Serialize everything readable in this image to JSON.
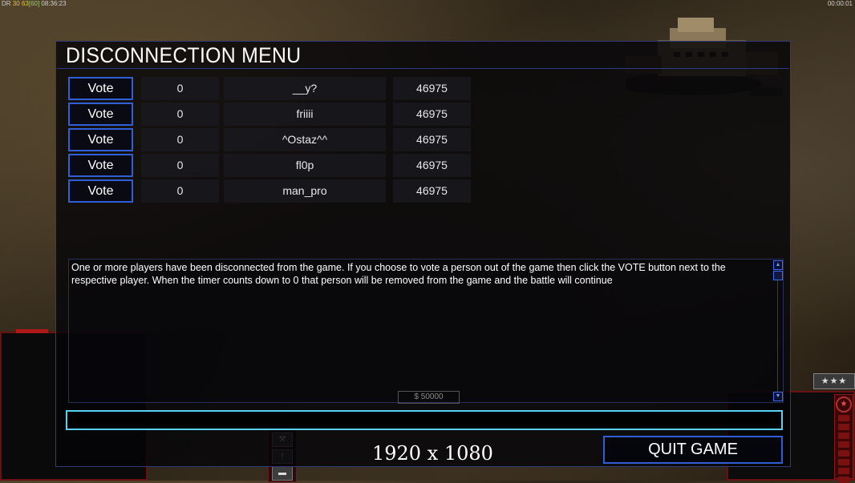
{
  "hud": {
    "top_left_prefix": "DR",
    "top_left_fps": "30",
    "top_left_a": "63",
    "top_left_b": "[60]",
    "top_left_clock": "08:36:23",
    "top_right_timer": "00:00:01"
  },
  "dialog": {
    "title": "DISCONNECTION MENU",
    "players": [
      {
        "vote_label": "Vote",
        "timer": "0",
        "name": "__y?",
        "ping": "46975"
      },
      {
        "vote_label": "Vote",
        "timer": "0",
        "name": "friiii",
        "ping": "46975"
      },
      {
        "vote_label": "Vote",
        "timer": "0",
        "name": "^Ostaz^^",
        "ping": "46975"
      },
      {
        "vote_label": "Vote",
        "timer": "0",
        "name": "fl0p",
        "ping": "46975"
      },
      {
        "vote_label": "Vote",
        "timer": "0",
        "name": "man_pro",
        "ping": "46975"
      }
    ],
    "message": "One or more players have been disconnected from the game. If you choose to vote a person out of the game then click the VOTE button next to the respective player. When the timer counts down to 0 that person will be removed from the game and the battle will continue",
    "chat_value": "",
    "quit_label": "QUIT GAME",
    "resolution_label": "1920 x 1080"
  },
  "background_hud": {
    "money": "$ 50000",
    "rank_stars": "★★★"
  },
  "colors": {
    "dialog_border": "#2f3a78",
    "button_border": "#2f5fd8",
    "chat_border": "#58d2f2",
    "hud_red": "#7a1010"
  }
}
